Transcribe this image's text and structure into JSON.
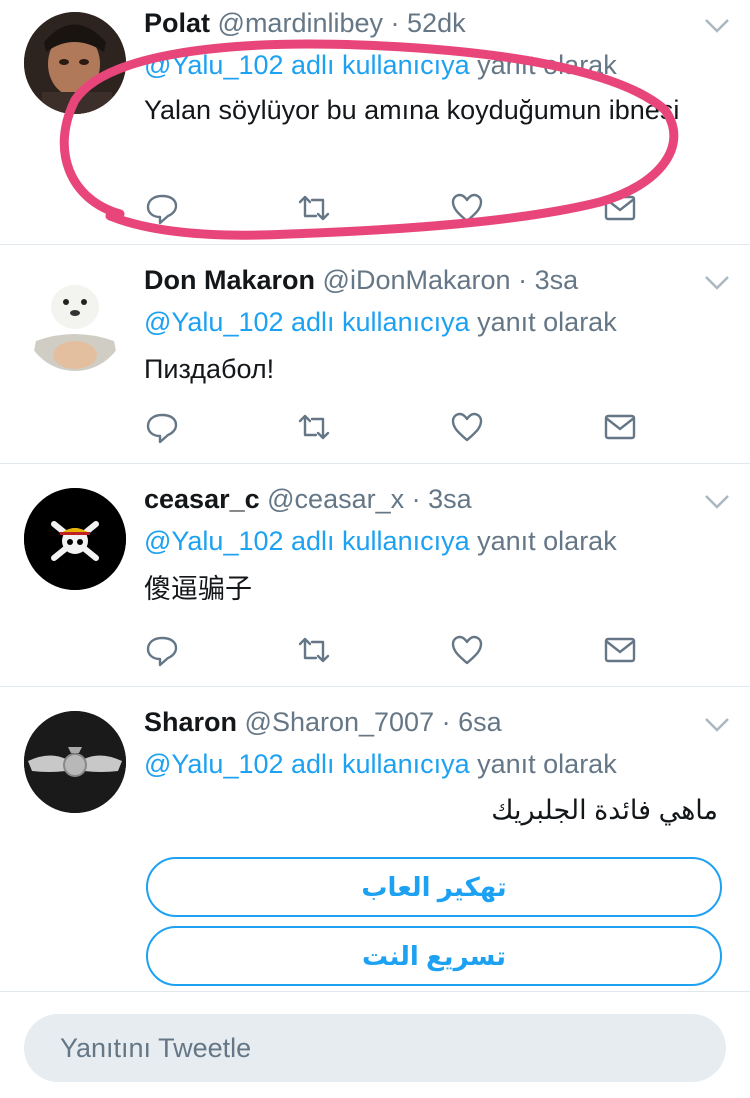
{
  "tweets": [
    {
      "name": "Polat",
      "handle": "@mardinlibey",
      "time": "52dk",
      "reply_user": "@Yalu_102 adlı kullanıcıya",
      "reply_rest": "yanıt olarak",
      "text": "Yalan söylüyor bu amına koyduğumun ibnesi"
    },
    {
      "name": "Don Makaron",
      "handle": "@iDonMakaron",
      "time": "3sa",
      "reply_user": "@Yalu_102 adlı kullanıcıya",
      "reply_rest": "yanıt olarak",
      "text": "Пиздабол!"
    },
    {
      "name": "ceasar_c",
      "handle": "@ceasar_x",
      "time": "3sa",
      "reply_user": "@Yalu_102 adlı kullanıcıya",
      "reply_rest": "yanıt olarak",
      "text": "傻逼骗子"
    },
    {
      "name": "Sharon",
      "handle": "@Sharon_7007",
      "time": "6sa",
      "reply_user": "@Yalu_102 adlı kullanıcıya",
      "reply_rest": "yanıt olarak",
      "text": "ماهي فائدة الجلبريك",
      "buttons": [
        "تهكير العاب",
        "تسريع النت"
      ]
    }
  ],
  "meta_separator": "·",
  "compose": {
    "placeholder": "Yanıtını Tweetle"
  },
  "colors": {
    "accent": "#1da1f2",
    "secondary_text": "#657786",
    "highlight_scribble": "#e8467a"
  },
  "icons": [
    "reply-icon",
    "retweet-icon",
    "like-icon",
    "direct-message-icon",
    "chevron-down-icon"
  ]
}
